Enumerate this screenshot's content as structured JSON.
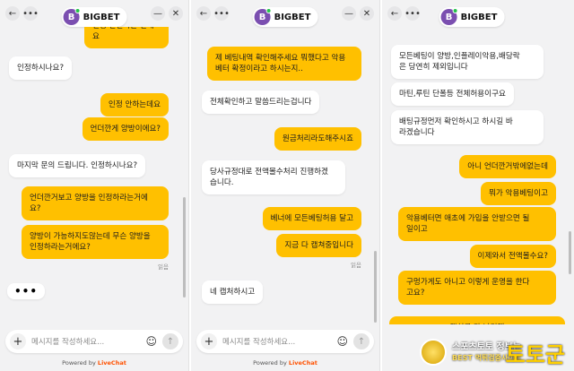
{
  "brand": {
    "name": "BIGBET",
    "initial": "B"
  },
  "composer": {
    "placeholder": "메시지를 작성하세요...",
    "footer_prefix": "Powered by",
    "footer_brand": "LiveChat"
  },
  "panel1": {
    "messages": [
      {
        "role": "user",
        "text": "인정 안한다는 건데요"
      },
      {
        "role": "agent",
        "text": "인정하시나요?"
      },
      {
        "role": "user",
        "text": "인정 안하는데요"
      },
      {
        "role": "user",
        "text": "언더깐게 양방이에요?"
      },
      {
        "role": "agent",
        "text": "마지막 문의 드립니다. 인정하시나요?"
      },
      {
        "role": "user",
        "text": "언더깐거보고 양방을 인정하라는거에\n요?"
      },
      {
        "role": "user",
        "text": "양방이 가능하지도않는데 무슨 양방을\n인정하라는거에요?"
      }
    ],
    "read_label": "읽음",
    "typing": "•••"
  },
  "panel2": {
    "messages": [
      {
        "role": "user",
        "text": "제 베팅내역 확인해주세요 뭐했다고 악용\n베터 확정이라고 하시는지.."
      },
      {
        "role": "agent",
        "text": "전체확인하고 말씀드리는겁니다"
      },
      {
        "role": "user",
        "text": "원금처리라도해주시죠"
      },
      {
        "role": "agent",
        "text": "당사규정대로 전액몰수처리 진행하겠\n습니다."
      },
      {
        "role": "user",
        "text": "베너에 모든베팅허용 달고"
      },
      {
        "role": "user",
        "text": "지금 다 캡쳐중입니다"
      },
      {
        "role": "agent",
        "text": "네 캡처하시고"
      }
    ],
    "read_label": "읽음"
  },
  "panel3": {
    "messages": [
      {
        "role": "agent",
        "text": "모든베팅이 양방,인플레이악용,배당락\n은 당연히 제외입니다"
      },
      {
        "role": "agent",
        "text": "마틴,루틴 단폴등 전체허용이구요"
      },
      {
        "role": "agent",
        "text": "배팅규정먼저 확인하시고 하시길 바\n라겠습니다"
      },
      {
        "role": "user",
        "text": "아니 언더깐거밖에없는데"
      },
      {
        "role": "user",
        "text": "뭐가 악용베팅이고"
      },
      {
        "role": "user",
        "text": "악용베터면 애초에 가입을 안받으면 될\n일이고"
      },
      {
        "role": "user",
        "text": "이제와서 전액몰수요?"
      },
      {
        "role": "user",
        "text": "구멍가게도 아니고 이렇게 운영을 한다\n고요?"
      },
      {
        "role": "user",
        "text": "캡처를 다 남기겠"
      }
    ]
  },
  "watermark": {
    "line1": "스포츠토토 정보는",
    "line2": "BEST 먹튀검증사이트",
    "line3": "토토군"
  }
}
